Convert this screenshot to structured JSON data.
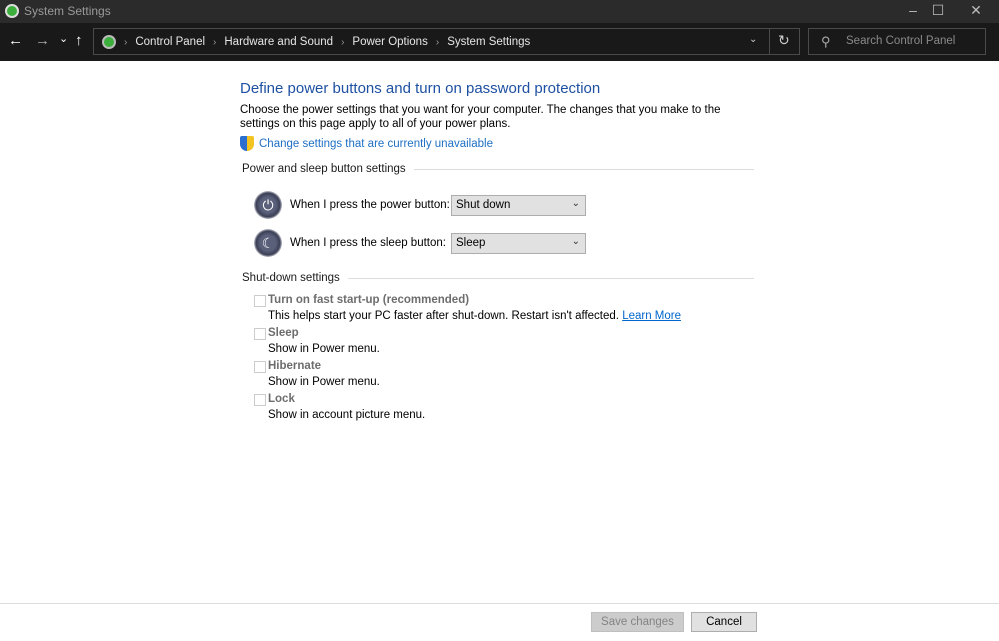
{
  "window": {
    "title": "System Settings",
    "minimize": "–",
    "maximize": "☐",
    "close": "✕"
  },
  "nav": {
    "back": "←",
    "forward": "→",
    "recent": "⌄",
    "up": "↑",
    "breadcrumb": [
      "Control Panel",
      "Hardware and Sound",
      "Power Options",
      "System Settings"
    ],
    "refresh": "↻",
    "dropdown": "⌄",
    "search_placeholder": "Search Control Panel"
  },
  "page": {
    "title": "Define power buttons and turn on password protection",
    "description": "Choose the power settings that you want for your computer. The changes that you make to the settings on this page apply to all of your power plans.",
    "change_link": "Change settings that are currently unavailable",
    "power_group": "Power and sleep button settings",
    "power_label": "When I press the power button:",
    "power_value": "Shut down",
    "sleep_label": "When I press the sleep button:",
    "sleep_value": "Sleep",
    "shutdown_group": "Shut-down settings",
    "options": [
      {
        "label": "Turn on fast start-up (recommended)",
        "desc": "This helps start your PC faster after shut-down. Restart isn't affected.",
        "link": "Learn More",
        "checked": false
      },
      {
        "label": "Sleep",
        "desc": "Show in Power menu.",
        "checked": false
      },
      {
        "label": "Hibernate",
        "desc": "Show in Power menu.",
        "checked": false
      },
      {
        "label": "Lock",
        "desc": "Show in account picture menu.",
        "checked": false
      }
    ],
    "save": "Save changes",
    "cancel": "Cancel"
  },
  "colors": {
    "link": "#1e6fc4",
    "heading": "#1e50a2",
    "titlebar": "#2b2b2b",
    "navbar": "#191919"
  }
}
